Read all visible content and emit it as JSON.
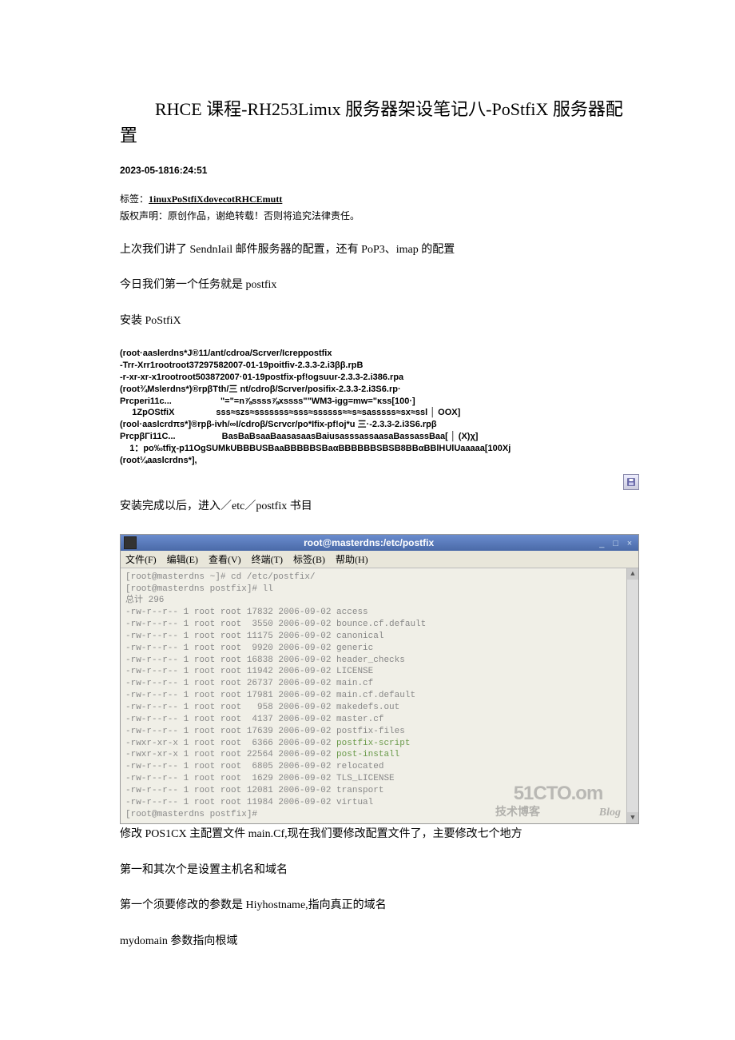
{
  "title": "RHCE 课程-RH253Limιx 服务器架设笔记八-PoStfiX 服务器配置",
  "meta_date": "2023-05-1816:24:51",
  "tags_label": "标签：",
  "tags_link": "1inuxPoStfiXdovecotRHCEmutt",
  "copyright": "版权声明：原创作品，谢绝转载！否则将追究法律责任。",
  "body1": "上次我们讲了 SendnIail 邮件服务器的配置，还有 PoP3、imap 的配置",
  "body2": "今日我们第一个任务就是 postfix",
  "body3": "安装 PoStfiX",
  "codeblock": "(root·aaslerdns*J®11/ant/cdroa/Scrver/Icreppostfix\n-Trr-Xrr1rootroot37297582007-01-19poitfiv-2.3.3-2.i3ββ.rpB\n-r-xr-xr-x1rootroot503872007·01-19postfix-pf!ogsuur-2.3.3-2.i386.rpa\n(root¾Mslerdns*)®rpβTth/三 nt/cdroβ/Scrver/posifix-2.3.3-2.i3S6.rp·\nPrcperi11c...                    \"=\"=n⅞ssss⅞xssss\"\"WM3-igg=mw=\"ĸss[100·]\n     1ZpOStfiX                 sss≈szs≈sssssss≈sss≈ssssss≈≈s≈sasssss≈sx≈ssl │ OOX]\n(rool·aaslcrdπs*]®rpβ-ivh/∞I/cdroβ/Scrvcr/po*Ifix-pf!oj*u 三·-2.3.3-2.i3S6.rpβ\nPrcpβΓi11C...                   BasBaBsaaBaasasaasBaiusasssassaasaBassassBaa[ │ (X)χ]\n    1：po‰tfiχ-p11OgSUMkUBBBUSBaaBBBBBSBaαBBBBBBSBSB8BBαBBlHUlUaaaaa[100Xj\n(root¼aaslcrdns*],",
  "body4": "安装完成以后，进入／etc／postfix 书目",
  "terminal": {
    "title": "root@masterdns:/etc/postfix",
    "menu": {
      "file": "文件(F)",
      "edit": "编辑(E)",
      "view": "查看(V)",
      "terminal": "终端(T)",
      "tabs": "标签(B)",
      "help": "帮助(H)"
    },
    "lines": [
      "[root@masterdns ~]# cd /etc/postfix/",
      "[root@masterdns postfix]# ll",
      "总计 296",
      "-rw-r--r-- 1 root root 17832 2006-09-02 access",
      "-rw-r--r-- 1 root root  3550 2006-09-02 bounce.cf.default",
      "-rw-r--r-- 1 root root 11175 2006-09-02 canonical",
      "-rw-r--r-- 1 root root  9920 2006-09-02 generic",
      "-rw-r--r-- 1 root root 16838 2006-09-02 header_checks",
      "-rw-r--r-- 1 root root 11942 2006-09-02 LICENSE",
      "-rw-r--r-- 1 root root 26737 2006-09-02 main.cf",
      "-rw-r--r-- 1 root root 17981 2006-09-02 main.cf.default",
      "-rw-r--r-- 1 root root   958 2006-09-02 makedefs.out",
      "-rw-r--r-- 1 root root  4137 2006-09-02 master.cf",
      "-rw-r--r-- 1 root root 17639 2006-09-02 postfix-files",
      "-rwxr-xr-x 1 root root  6366 2006-09-02 ",
      "-rwxr-xr-x 1 root root 22564 2006-09-02 ",
      "-rw-r--r-- 1 root root  6805 2006-09-02 relocated",
      "-rw-r--r-- 1 root root  1629 2006-09-02 TLS_LICENSE",
      "-rw-r--r-- 1 root root 12081 2006-09-02 transport",
      "-rw-r--r-- 1 root root 11984 2006-09-02 virtual",
      "[root@masterdns postfix]#"
    ],
    "green1": "postfix-script",
    "green2": "post-install",
    "winbtns": {
      "min": "_",
      "max": "□",
      "close": "×"
    }
  },
  "watermark": {
    "line1": "51CTO.om",
    "line2a": "技术博客",
    "line2b": "Blog"
  },
  "body5": "修改 POS1CX 主配置文件 main.Cf,现在我们要修改配置文件了，主要修改七个地方",
  "body6": "第一和其次个是设置主机名和域名",
  "body7": "第一个须要修改的参数是 Hiyhostname,指向真正的域名",
  "body8": "mydomain 参数指向根域"
}
